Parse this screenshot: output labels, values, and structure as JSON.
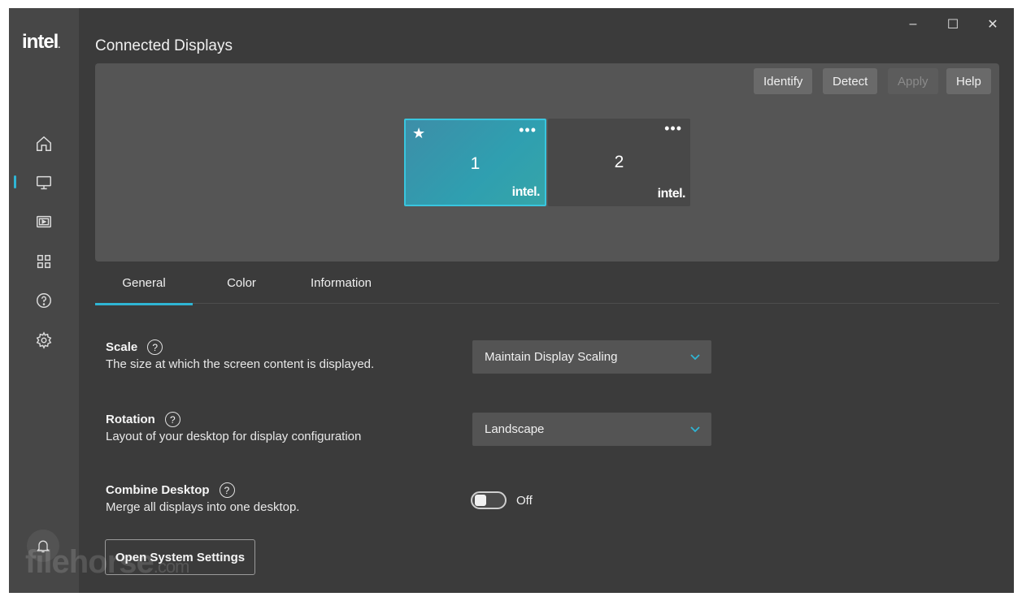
{
  "sidebar": {
    "logo_text": "intel",
    "logo_dot": ".",
    "items": [
      {
        "name": "home-icon"
      },
      {
        "name": "display-icon"
      },
      {
        "name": "video-icon"
      },
      {
        "name": "apps-grid-icon"
      },
      {
        "name": "help-circle-icon"
      },
      {
        "name": "gear-icon"
      }
    ],
    "active_index": 1,
    "accent_color": "#2fb5d4"
  },
  "window_controls": {
    "minimize": "–",
    "maximize": "☐",
    "close": "✕"
  },
  "page_title": "Connected Displays",
  "toolbar": {
    "identify": "Identify",
    "detect": "Detect",
    "apply": "Apply",
    "help": "Help"
  },
  "displays": [
    {
      "number": "1",
      "brand": "intel.",
      "menu": "•••",
      "primary_mark": "★",
      "selected": true
    },
    {
      "number": "2",
      "brand": "intel.",
      "menu": "•••",
      "selected": false
    }
  ],
  "tabs": [
    {
      "label": "General",
      "active": true
    },
    {
      "label": "Color"
    },
    {
      "label": "Information"
    }
  ],
  "settings": {
    "scale": {
      "title": "Scale",
      "description": "The size at which the screen content is displayed.",
      "value": "Maintain Display Scaling"
    },
    "rotation": {
      "title": "Rotation",
      "description": "Layout of your desktop for display configuration",
      "value": "Landscape"
    },
    "combine_desktop": {
      "title": "Combine Desktop",
      "description": "Merge all displays into one desktop.",
      "state": "Off"
    }
  },
  "open_system_settings": "Open System Settings",
  "help_glyph": "?",
  "watermark": {
    "text": "filehorse",
    "suffix": ".com"
  }
}
